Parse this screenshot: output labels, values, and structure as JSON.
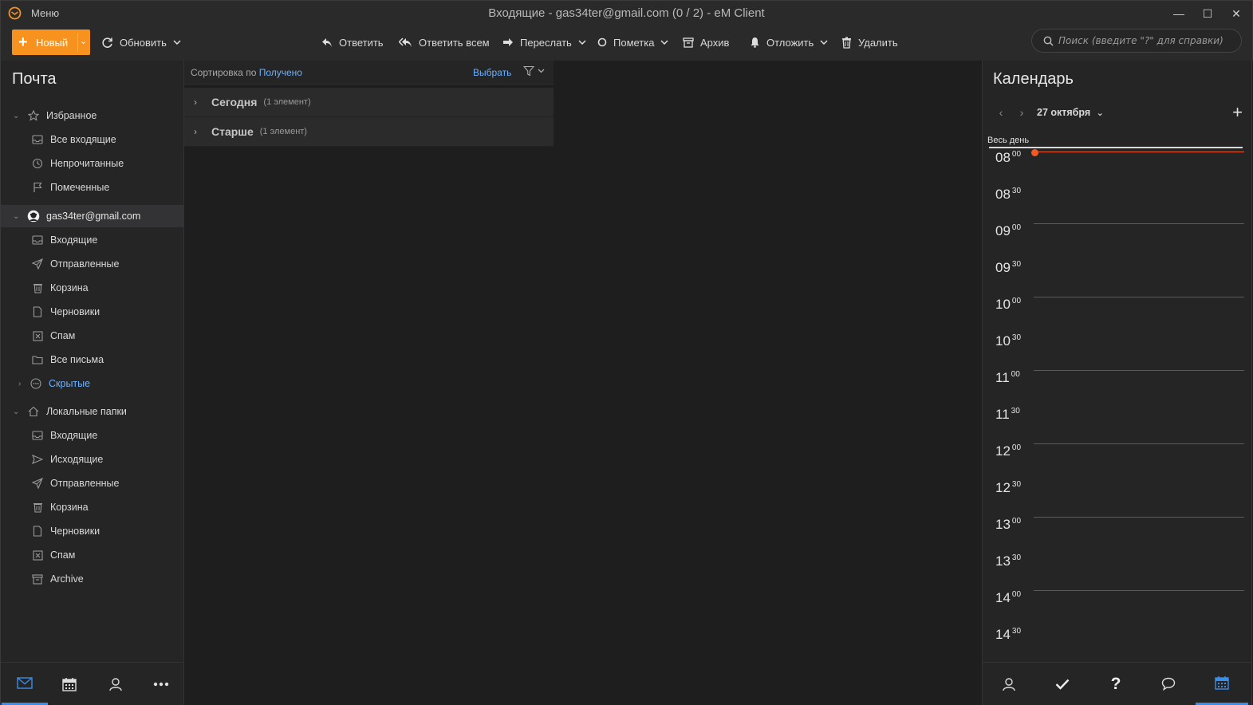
{
  "titlebar": {
    "menu": "Меню",
    "title": "Входящие - gas34ter@gmail.com (0 / 2) - eM Client"
  },
  "toolbar": {
    "new_label": "Новый",
    "refresh_label": "Обновить",
    "reply_label": "Ответить",
    "reply_all_label": "Ответить всем",
    "forward_label": "Переслать",
    "flag_label": "Пометка",
    "archive_label": "Архив",
    "snooze_label": "Отложить",
    "delete_label": "Удалить",
    "search_placeholder": "Поиск (введите \"?\" для справки)"
  },
  "sidebar": {
    "heading": "Почта",
    "favorites": {
      "label": "Избранное",
      "items": [
        "Все входящие",
        "Непрочитанные",
        "Помеченные"
      ]
    },
    "account": {
      "label": "gas34ter@gmail.com",
      "items": [
        "Входящие",
        "Отправленные",
        "Корзина",
        "Черновики",
        "Спам",
        "Все письма"
      ],
      "hidden": "Скрытые"
    },
    "local": {
      "label": "Локальные папки",
      "items": [
        "Входящие",
        "Исходящие",
        "Отправленные",
        "Корзина",
        "Черновики",
        "Спам",
        "Archive"
      ]
    }
  },
  "msglist": {
    "sort_prefix": "Сортировка по",
    "sort_value": "Получено",
    "select_label": "Выбрать",
    "groups": [
      {
        "title": "Сегодня",
        "count": "(1 элемент)"
      },
      {
        "title": "Старше",
        "count": "(1 элемент)"
      }
    ]
  },
  "calendar": {
    "title": "Календарь",
    "date": "27 октября",
    "all_day": "Весь день",
    "slots": [
      {
        "h": "08",
        "m": "00"
      },
      {
        "h": "08",
        "m": "30"
      },
      {
        "h": "09",
        "m": "00"
      },
      {
        "h": "09",
        "m": "30"
      },
      {
        "h": "10",
        "m": "00"
      },
      {
        "h": "10",
        "m": "30"
      },
      {
        "h": "11",
        "m": "00"
      },
      {
        "h": "11",
        "m": "30"
      },
      {
        "h": "12",
        "m": "00"
      },
      {
        "h": "12",
        "m": "30"
      },
      {
        "h": "13",
        "m": "00"
      },
      {
        "h": "13",
        "m": "30"
      },
      {
        "h": "14",
        "m": "00"
      },
      {
        "h": "14",
        "m": "30"
      }
    ]
  },
  "colors": {
    "accent_orange": "#f7921e",
    "link_blue": "#6ab0ff",
    "now_indicator": "#f15a24",
    "active_nav": "#3b8ee8"
  }
}
